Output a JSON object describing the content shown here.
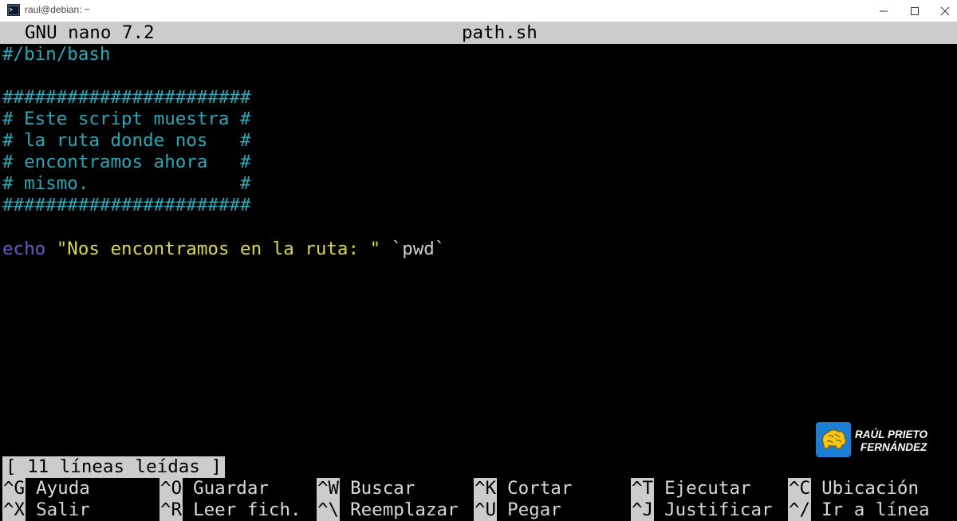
{
  "window": {
    "title": "raul@debian: ~",
    "icons": {
      "app": "terminal-icon",
      "minimize": "minimize-icon",
      "maximize": "maximize-icon",
      "close": "close-icon"
    }
  },
  "nano": {
    "version": "GNU nano 7.2",
    "filename": "path.sh"
  },
  "editor": {
    "shebang": "#/bin/bash",
    "comment_lines": [
      "#######################",
      "# Este script muestra #",
      "# la ruta donde nos   #",
      "# encontramos ahora   #",
      "# mismo.              #",
      "#######################"
    ],
    "echo_kw": "echo",
    "echo_str": "\"Nos encontramos en la ruta: \"",
    "echo_cmd": "`pwd`"
  },
  "status_message": "[ 11 líneas leídas ]",
  "shortcuts_row1": [
    {
      "key": "^G",
      "label": "Ayuda"
    },
    {
      "key": "^O",
      "label": "Guardar"
    },
    {
      "key": "^W",
      "label": "Buscar"
    },
    {
      "key": "^K",
      "label": "Cortar"
    },
    {
      "key": "^T",
      "label": "Ejecutar"
    },
    {
      "key": "^C",
      "label": "Ubicación"
    }
  ],
  "shortcuts_row2": [
    {
      "key": "^X",
      "label": "Salir"
    },
    {
      "key": "^R",
      "label": "Leer fich."
    },
    {
      "key": "^\\",
      "label": "Reemplazar"
    },
    {
      "key": "^U",
      "label": "Pegar"
    },
    {
      "key": "^J",
      "label": "Justificar"
    },
    {
      "key": "^/",
      "label": "Ir a línea"
    }
  ],
  "watermark": {
    "line1": "RAÚL PRIETO",
    "line2": "FERNÁNDEZ",
    "color": "#1a7fd4"
  }
}
